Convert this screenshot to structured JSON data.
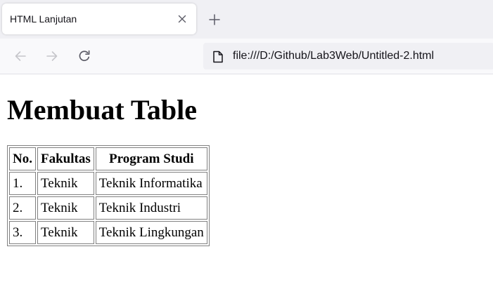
{
  "browser": {
    "tab": {
      "title": "HTML Lanjutan",
      "close_icon": "close-icon"
    },
    "new_tab_icon": "plus-icon",
    "nav": {
      "back_icon": "arrow-left-icon",
      "forward_icon": "arrow-right-icon",
      "reload_icon": "reload-icon"
    },
    "url": {
      "icon": "file-icon",
      "value": "file:///D:/Github/Lab3Web/Untitled-2.html"
    }
  },
  "page": {
    "heading": "Membuat Table",
    "table": {
      "headers": [
        "No.",
        "Fakultas",
        "Program Studi"
      ],
      "rows": [
        [
          "1.",
          "Teknik",
          "Teknik Informatika"
        ],
        [
          "2.",
          "Teknik",
          "Teknik Industri"
        ],
        [
          "3.",
          "Teknik",
          "Teknik Lingkungan"
        ]
      ]
    }
  },
  "colors": {
    "tabstrip_bg": "#f0f0f4",
    "toolbar_bg": "#f9f9fb",
    "urlbar_bg": "#f0f0f4",
    "table_border": "#808080",
    "icon_disabled": "#c6c6ca",
    "icon_enabled": "#5b5b66"
  }
}
